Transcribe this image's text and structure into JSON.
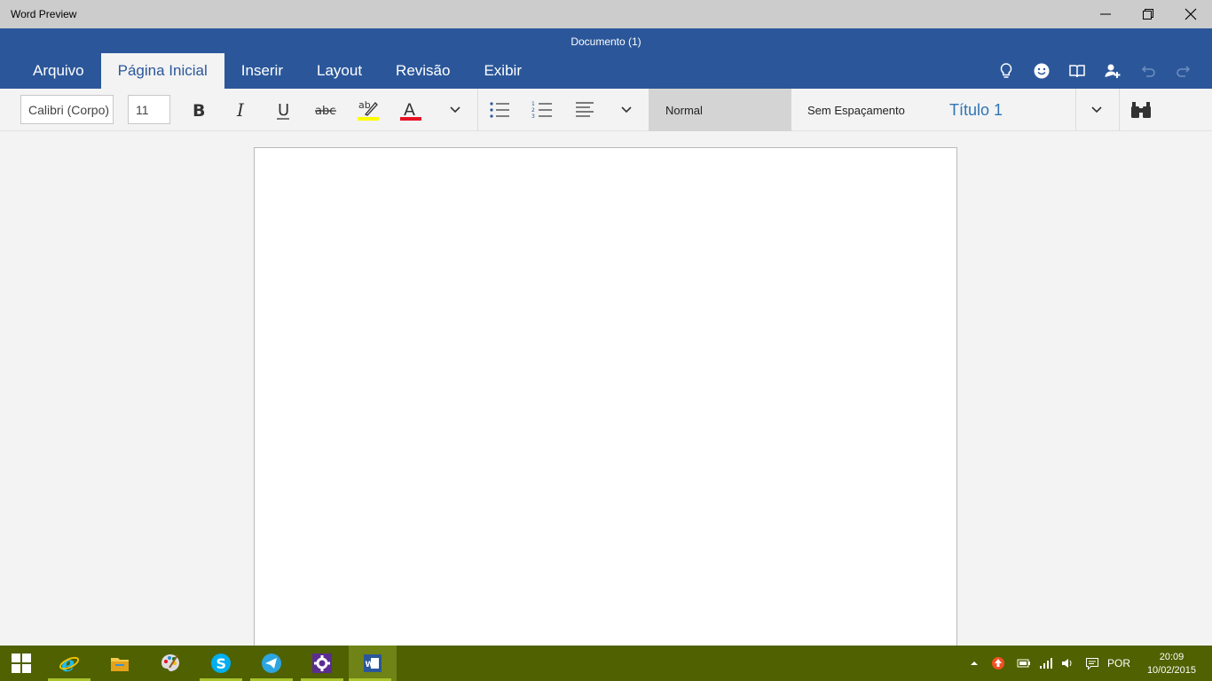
{
  "window": {
    "title": "Word Preview",
    "controls": [
      "minimize",
      "restore",
      "close"
    ]
  },
  "document": {
    "title": "Documento (1)"
  },
  "tabs": [
    {
      "label": "Arquivo",
      "active": false
    },
    {
      "label": "Página Inicial",
      "active": true
    },
    {
      "label": "Inserir",
      "active": false
    },
    {
      "label": "Layout",
      "active": false
    },
    {
      "label": "Revisão",
      "active": false
    },
    {
      "label": "Exibir",
      "active": false
    }
  ],
  "header_icons": [
    "lightbulb-icon",
    "smiley-icon",
    "book-icon",
    "share-person-icon",
    "undo-icon",
    "redo-icon"
  ],
  "toolbar": {
    "font_name": "Calibri (Corpo)",
    "font_size": "11",
    "format_buttons": [
      "bold",
      "italic",
      "underline",
      "strikethrough",
      "highlight",
      "font-color",
      "more"
    ],
    "bold_label": "B",
    "italic_label": "I",
    "underline_label": "U",
    "strike_label": "abc",
    "highlight_label": "ab",
    "fontcolor_label": "A",
    "highlight_color": "#ffff00",
    "font_color": "#e81123",
    "paragraph_buttons": [
      "bullets",
      "numbering",
      "align",
      "more"
    ]
  },
  "styles": [
    {
      "label": "Normal",
      "selected": true
    },
    {
      "label": "Sem Espaçamento",
      "selected": false
    },
    {
      "label": "Título 1",
      "selected": false
    }
  ],
  "taskbar": {
    "apps": [
      "windows-start",
      "internet-explorer",
      "file-explorer",
      "paint",
      "skype",
      "telegram",
      "settings",
      "word"
    ],
    "language": "POR",
    "time": "20:09",
    "date": "10/02/2015"
  },
  "colors": {
    "accent": "#2b579a",
    "taskbar": "#4f6100",
    "titlebar": "#cccccc"
  }
}
